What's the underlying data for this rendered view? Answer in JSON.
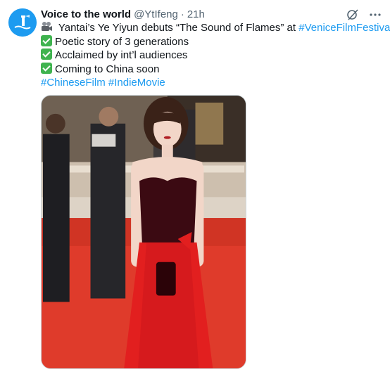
{
  "author": {
    "display_name": "Voice to the world",
    "handle": "@YtIfeng",
    "separator": "·",
    "time": "21h",
    "avatar_icon": "lighthouse-logo-icon"
  },
  "header_icons": {
    "grok": "grok-icon",
    "more": "more-icon",
    "more_glyph": "···"
  },
  "tweet": {
    "line1_icon": "movie-camera-icon",
    "line1_text": " Yantai’s Ye Yiyun debuts “The Sound of Flames” at ",
    "line1_link": "#VeniceFilmFestival",
    "line1_end": "!",
    "bullets": [
      "Poetic story of 3 generations",
      "Acclaimed by int’l audiences",
      "Coming to China soon"
    ],
    "bullet_icon": "check-mark-button-icon",
    "hashtags": [
      "#ChineseFilm",
      "#IndieMovie"
    ]
  },
  "media": {
    "description_icon": "photo"
  },
  "colors": {
    "link": "#1d9bf0",
    "text": "#0f1419",
    "muted": "#536471",
    "avatar_bg": "#1d9bf0",
    "check_bg": "#3fb34f"
  }
}
